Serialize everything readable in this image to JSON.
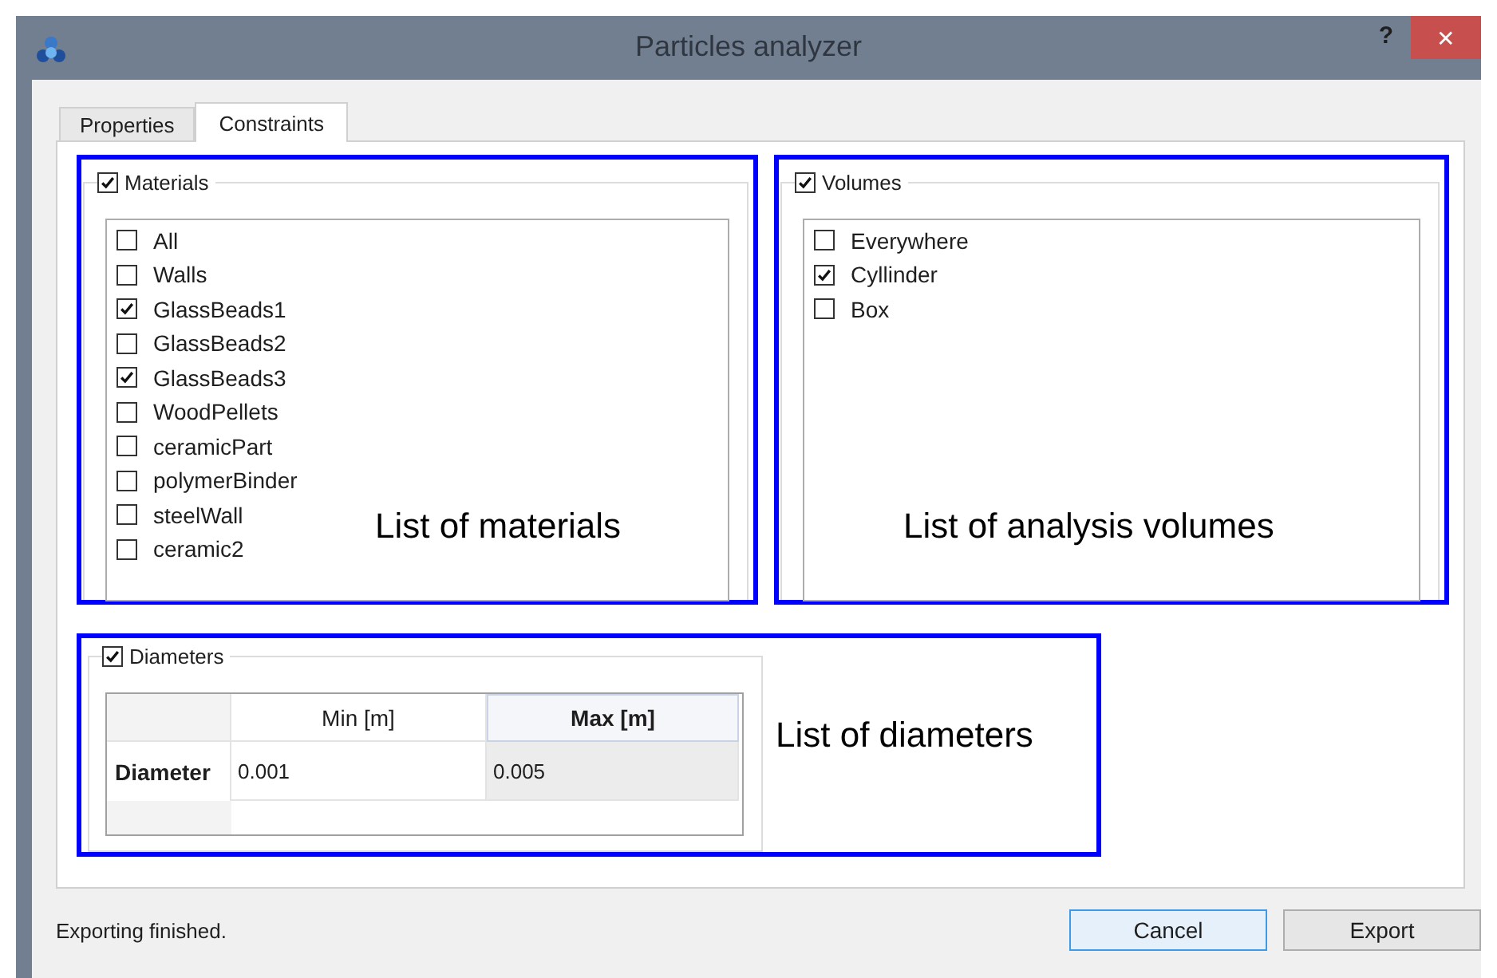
{
  "window": {
    "title": "Particles analyzer",
    "help": "?",
    "close": "✕"
  },
  "tabs": [
    {
      "label": "Properties",
      "selected": false
    },
    {
      "label": "Constraints",
      "selected": true
    }
  ],
  "materials": {
    "title": "Materials",
    "checked": true,
    "annotation": "List of materials",
    "items": [
      {
        "label": "All",
        "checked": false
      },
      {
        "label": "Walls",
        "checked": false
      },
      {
        "label": "GlassBeads1",
        "checked": true
      },
      {
        "label": "GlassBeads2",
        "checked": false
      },
      {
        "label": "GlassBeads3",
        "checked": true
      },
      {
        "label": "WoodPellets",
        "checked": false
      },
      {
        "label": "ceramicPart",
        "checked": false
      },
      {
        "label": "polymerBinder",
        "checked": false
      },
      {
        "label": "steelWall",
        "checked": false
      },
      {
        "label": "ceramic2",
        "checked": false
      }
    ]
  },
  "volumes": {
    "title": "Volumes",
    "checked": true,
    "annotation": "List of analysis volumes",
    "items": [
      {
        "label": "Everywhere",
        "checked": false
      },
      {
        "label": "Cyllinder",
        "checked": true
      },
      {
        "label": "Box",
        "checked": false
      }
    ]
  },
  "diameters": {
    "title": "Diameters",
    "checked": true,
    "annotation": "List of diameters",
    "table": {
      "columns": [
        {
          "label": "Min [m]",
          "selected": false
        },
        {
          "label": "Max [m]",
          "selected": true
        }
      ],
      "rows": [
        {
          "header": "Diameter",
          "cells": [
            {
              "value": "0.001",
              "selected": false
            },
            {
              "value": "0.005",
              "selected": true
            }
          ]
        }
      ]
    }
  },
  "status": "Exporting finished.",
  "buttons": [
    {
      "label": "Cancel",
      "focused": true
    },
    {
      "label": "Export",
      "focused": false
    }
  ]
}
